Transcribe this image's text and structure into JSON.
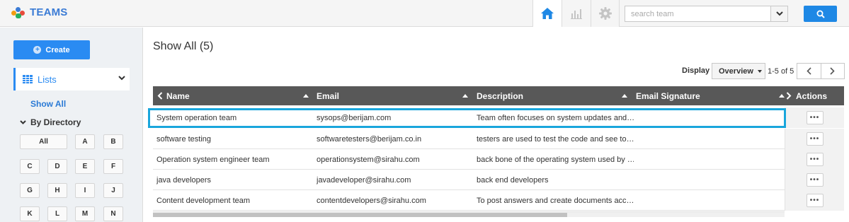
{
  "app": {
    "title": "TEAMS"
  },
  "nav": {
    "home_icon": "home-icon",
    "reports_icon": "bar-chart-icon",
    "settings_icon": "gear-icon"
  },
  "search": {
    "placeholder": "search team",
    "value": ""
  },
  "sidebar": {
    "create_label": "Create",
    "lists_label": "Lists",
    "show_all": "Show All",
    "by_directory": "By Directory",
    "letters": [
      "All",
      "A",
      "B",
      "C",
      "D",
      "E",
      "F",
      "G",
      "H",
      "I",
      "J",
      "K",
      "L",
      "M",
      "N"
    ]
  },
  "main": {
    "title": "Show All (5)",
    "display_label": "Display",
    "display_value": "Overview",
    "pager_text": "1-5 of 5"
  },
  "table": {
    "columns": [
      "Name",
      "Email",
      "Description",
      "Email Signature",
      "Actions"
    ],
    "rows": [
      {
        "name": "System operation team",
        "email": "sysops@berijam.com",
        "description": "Team often focuses on system updates and…",
        "signature": "",
        "actions": "•••"
      },
      {
        "name": "software testing",
        "email": "softwaretesters@berijam.co.in",
        "description": "testers are used to test the code and see to…",
        "signature": "",
        "actions": "•••"
      },
      {
        "name": "Operation system engineer team",
        "email": "operationsystem@sirahu.com",
        "description": "back bone of the operating system used by …",
        "signature": "",
        "actions": "•••"
      },
      {
        "name": "java developers",
        "email": "javadeveloper@sirahu.com",
        "description": "back end developers",
        "signature": "",
        "actions": "•••"
      },
      {
        "name": "Content development team",
        "email": "contentdevelopers@sirahu.com",
        "description": "To post answers and create documents acc…",
        "signature": "",
        "actions": "•••"
      }
    ]
  },
  "colors": {
    "accent": "#2a8bf2",
    "header_bg": "#585858",
    "highlight": "#19a6dc"
  }
}
